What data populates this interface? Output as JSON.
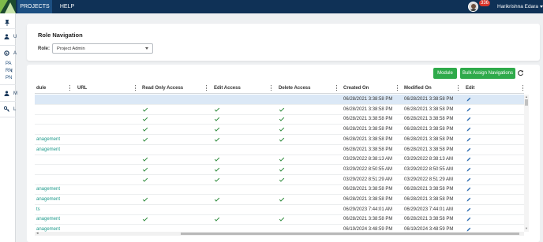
{
  "topbar": {
    "nav": [
      "PROJECTS",
      "HELP"
    ],
    "notification_count": "336",
    "username": "Harikrishna Edara"
  },
  "sidebar": {
    "items": [
      {
        "icon": "pin-icon",
        "letter": ""
      },
      {
        "icon": "user-icon",
        "letter": "U"
      },
      {
        "icon": "gear-icon",
        "letter": "A"
      },
      {
        "icon": "user-icon",
        "letter": "M"
      },
      {
        "icon": "key-icon",
        "letter": "L"
      }
    ],
    "subitems": [
      "PA",
      "RN",
      "PN"
    ]
  },
  "role_card": {
    "title": "Role Navigation",
    "role_label": "Role:",
    "role_value": "Project Admin"
  },
  "toolbar": {
    "module_label": "Module",
    "bulk_label": "Bulk Assign Navigations"
  },
  "table": {
    "columns": [
      "dule",
      "URL",
      "Read Only Access",
      "Edit Access",
      "Delete Access",
      "Created On",
      "Modified On",
      "Edit"
    ],
    "rows": [
      {
        "module": "",
        "read": false,
        "edit": false,
        "del": false,
        "created": "06/28/2021 3:38:58 PM",
        "modified": "06/28/2021 3:38:58 PM",
        "selected": true
      },
      {
        "module": "",
        "read": true,
        "edit": true,
        "del": true,
        "created": "06/28/2021 3:38:58 PM",
        "modified": "06/28/2021 3:38:58 PM",
        "selected": false
      },
      {
        "module": "",
        "read": true,
        "edit": true,
        "del": true,
        "created": "06/28/2021 3:38:58 PM",
        "modified": "06/28/2021 3:38:58 PM",
        "selected": false
      },
      {
        "module": "",
        "read": true,
        "edit": true,
        "del": true,
        "created": "06/28/2021 3:38:58 PM",
        "modified": "06/28/2021 3:38:58 PM",
        "selected": false
      },
      {
        "module": "anagement",
        "read": true,
        "edit": true,
        "del": true,
        "created": "06/28/2021 3:38:58 PM",
        "modified": "06/28/2021 3:38:58 PM",
        "selected": false
      },
      {
        "module": "anagement",
        "read": false,
        "edit": false,
        "del": false,
        "created": "06/28/2021 3:38:58 PM",
        "modified": "06/28/2021 3:38:58 PM",
        "selected": false
      },
      {
        "module": "",
        "read": true,
        "edit": true,
        "del": true,
        "created": "03/29/2022 8:38:13 AM",
        "modified": "03/29/2022 8:38:13 AM",
        "selected": false
      },
      {
        "module": "",
        "read": true,
        "edit": true,
        "del": true,
        "created": "03/29/2022 8:50:55 AM",
        "modified": "03/29/2022 8:50:55 AM",
        "selected": false
      },
      {
        "module": "",
        "read": true,
        "edit": true,
        "del": true,
        "created": "03/29/2022 8:51:29 AM",
        "modified": "03/29/2022 8:51:29 AM",
        "selected": false
      },
      {
        "module": "anagement",
        "read": false,
        "edit": false,
        "del": false,
        "created": "06/28/2021 3:38:58 PM",
        "modified": "06/28/2021 3:38:58 PM",
        "selected": false
      },
      {
        "module": "anagement",
        "read": true,
        "edit": true,
        "del": true,
        "created": "06/28/2021 3:38:58 PM",
        "modified": "06/28/2021 3:38:58 PM",
        "selected": false
      },
      {
        "module": "ts",
        "read": false,
        "edit": false,
        "del": false,
        "created": "06/29/2023 7:44:01 AM",
        "modified": "06/29/2023 7:44:01 AM",
        "selected": false
      },
      {
        "module": "anagement",
        "read": true,
        "edit": true,
        "del": true,
        "created": "06/28/2021 3:38:58 PM",
        "modified": "06/28/2021 3:38:58 PM",
        "selected": false
      },
      {
        "module": "anagement",
        "read": false,
        "edit": false,
        "del": false,
        "created": "06/19/2024 3:48:59 PM",
        "modified": "06/19/2024 3:48:59 PM",
        "selected": false
      }
    ]
  },
  "colors": {
    "topbar": "#0f3156",
    "active_nav": "#1c4f82",
    "button_green": "#2eaa4a",
    "check_green": "#2e8b3c",
    "module_teal": "#1e9a8b",
    "selected_row": "#dbe8f6",
    "badge_red": "#d9342b",
    "edit_icon": "#2f6fb3"
  },
  "icons": {
    "refresh": "refresh-icon",
    "edit": "pencil-icon",
    "check": "check-icon",
    "dropdown": "chevron-down-icon",
    "collapse": "chevron-left-icon"
  }
}
